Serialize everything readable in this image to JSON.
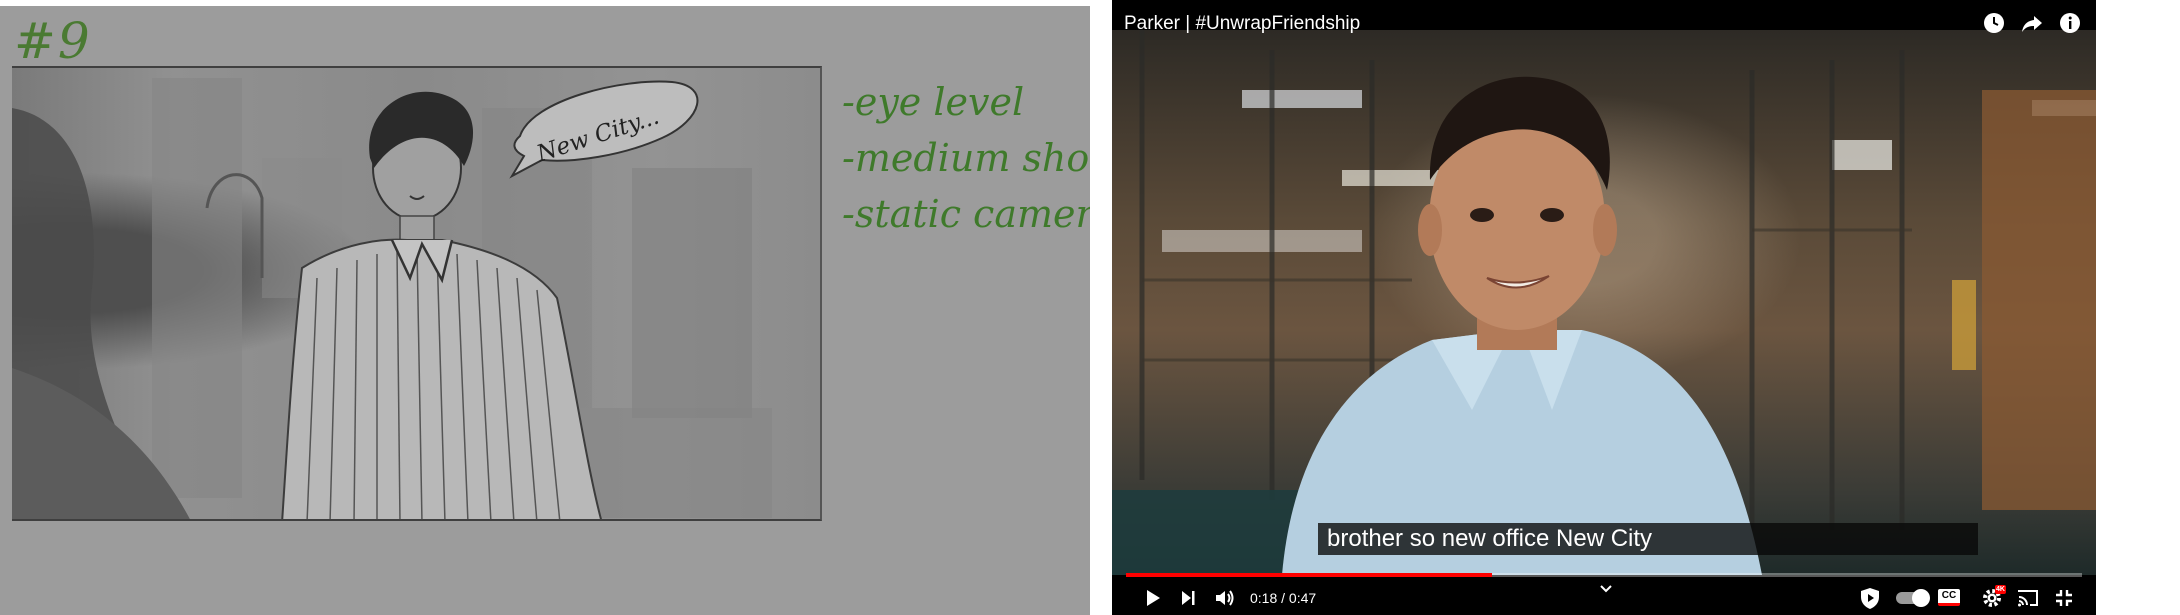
{
  "storyboard": {
    "panel_number": "#9",
    "speech_bubble": "New City...",
    "notes": [
      "-eye level",
      "-medium shot",
      "-static camera"
    ],
    "ink_color": "#3f7a2b"
  },
  "player": {
    "title": "Parker | #UnwrapFriendship",
    "caption": "brother so new office New City",
    "time_current": "0:18",
    "time_separator": " / ",
    "time_total": "0:47",
    "progress": 0.383,
    "hd_badge": "4K",
    "cc_label": "CC",
    "accent_color": "#ff0000",
    "icons": {
      "watch_later": "clock-icon",
      "share": "share-arrow-icon",
      "info": "info-icon",
      "play": "play-icon",
      "next": "next-icon",
      "volume": "volume-icon",
      "chapters": "chevron-down-icon",
      "shield": "shield-play-icon",
      "autoplay": "autoplay-toggle",
      "settings": "gear-icon",
      "cast": "cast-icon",
      "exit_fullscreen": "exit-fullscreen-icon"
    }
  }
}
